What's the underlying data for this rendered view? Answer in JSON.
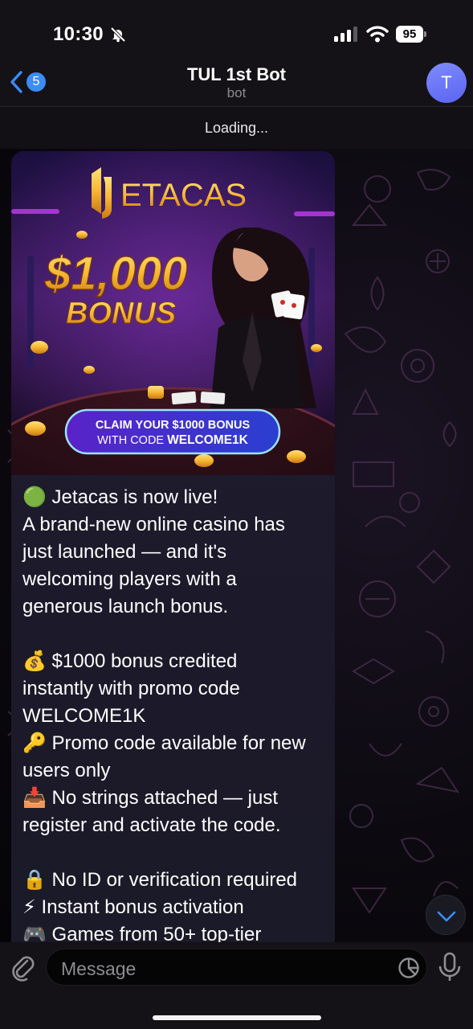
{
  "status_bar": {
    "time": "10:30",
    "battery": "95",
    "icons": [
      "mute-bell-icon",
      "cellular-signal-icon",
      "wifi-icon",
      "battery-icon"
    ]
  },
  "header": {
    "back_badge": "5",
    "title": "TUL 1st Bot",
    "subtitle": "bot",
    "avatar_letter": "T",
    "loading": "Loading..."
  },
  "promo": {
    "brand": "ETACAS",
    "amount": "$1,000",
    "bonus_word": "BONUS",
    "button_line1": "CLAIM YOUR $1000 BONUS",
    "button_line2_prefix": "WITH CODE ",
    "button_line2_code": "WELCOME1K"
  },
  "message": {
    "lines": [
      "🟢 Jetacas is now live!",
      "A brand-new online casino has",
      "just launched — and it's",
      "welcoming players with a",
      "generous launch bonus.",
      "",
      "💰 $1000 bonus credited",
      "instantly with promo code",
      "WELCOME1K",
      "🔑 Promo code available for new",
      "users only",
      "📥 No strings attached — just",
      "register and activate the code.",
      "",
      "🔒 No ID or verification required",
      "⚡ Instant bonus activation",
      "🎮 Games from 50+ top-tier"
    ]
  },
  "composer": {
    "placeholder": "Message"
  },
  "colors": {
    "accent_blue": "#3b8cf5",
    "avatar": "#6b74f5",
    "bubble": "#1f1c2e",
    "header": "#141216"
  }
}
